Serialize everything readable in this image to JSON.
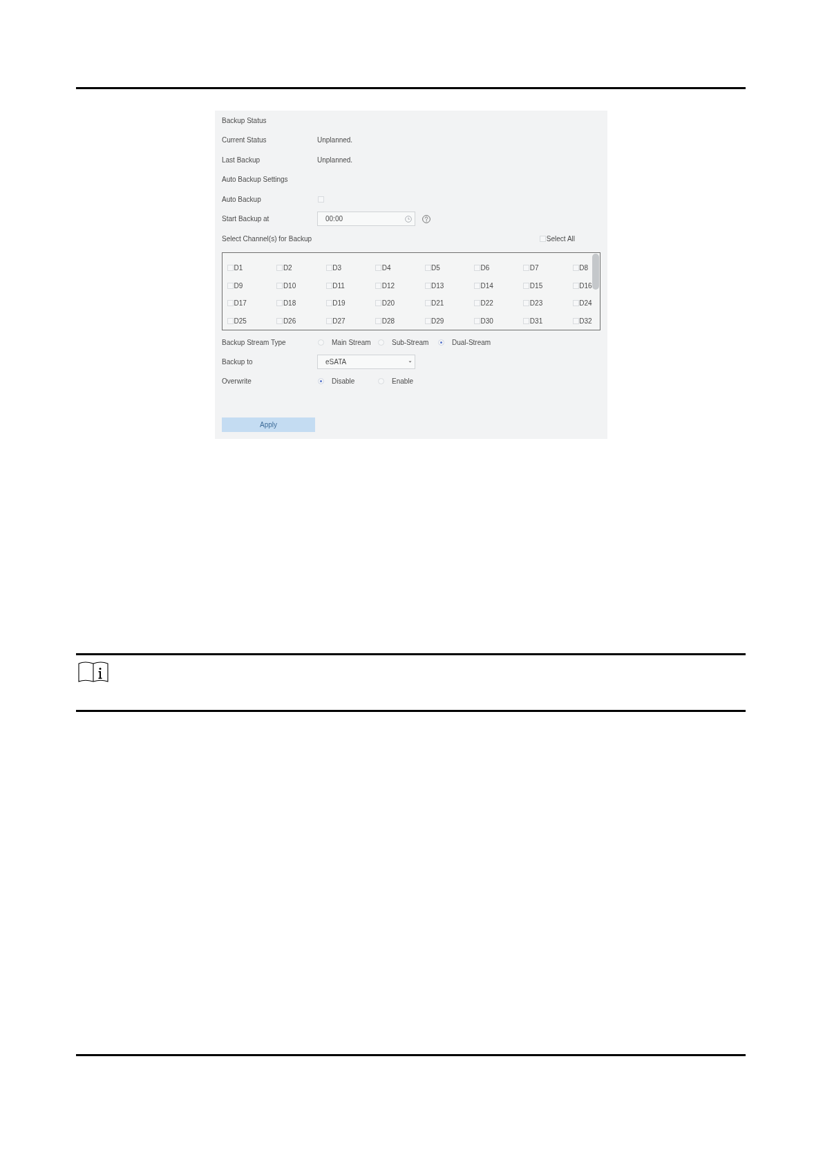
{
  "backup_status": {
    "title": "Backup Status",
    "fields": [
      {
        "label": "Current Status",
        "value": "Unplanned."
      },
      {
        "label": "Last Backup",
        "value": "Unplanned."
      }
    ]
  },
  "auto_backup_settings": {
    "title": "Auto Backup Settings",
    "auto_backup": {
      "label": "Auto Backup",
      "checked": false
    },
    "start_backup_at": {
      "label": "Start Backup at",
      "value": "00:00"
    },
    "channel_selection": {
      "label": "Select Channel(s) for Backup",
      "select_all": {
        "label": "Select All",
        "checked": false
      },
      "channels": [
        {
          "label": "D1",
          "checked": false
        },
        {
          "label": "D2",
          "checked": false
        },
        {
          "label": "D3",
          "checked": false
        },
        {
          "label": "D4",
          "checked": false
        },
        {
          "label": "D5",
          "checked": false
        },
        {
          "label": "D6",
          "checked": false
        },
        {
          "label": "D7",
          "checked": false
        },
        {
          "label": "D8",
          "checked": false
        },
        {
          "label": "D9",
          "checked": false
        },
        {
          "label": "D10",
          "checked": false
        },
        {
          "label": "D11",
          "checked": false
        },
        {
          "label": "D12",
          "checked": false
        },
        {
          "label": "D13",
          "checked": false
        },
        {
          "label": "D14",
          "checked": false
        },
        {
          "label": "D15",
          "checked": false
        },
        {
          "label": "D16",
          "checked": false
        },
        {
          "label": "D17",
          "checked": false
        },
        {
          "label": "D18",
          "checked": false
        },
        {
          "label": "D19",
          "checked": false
        },
        {
          "label": "D20",
          "checked": false
        },
        {
          "label": "D21",
          "checked": false
        },
        {
          "label": "D22",
          "checked": false
        },
        {
          "label": "D23",
          "checked": false
        },
        {
          "label": "D24",
          "checked": false
        },
        {
          "label": "D25",
          "checked": false
        },
        {
          "label": "D26",
          "checked": false
        },
        {
          "label": "D27",
          "checked": false
        },
        {
          "label": "D28",
          "checked": false
        },
        {
          "label": "D29",
          "checked": false
        },
        {
          "label": "D30",
          "checked": false
        },
        {
          "label": "D31",
          "checked": false
        },
        {
          "label": "D32",
          "checked": false
        }
      ]
    },
    "backup_stream_type": {
      "label": "Backup Stream Type",
      "options": [
        {
          "label": "Main Stream",
          "selected": false
        },
        {
          "label": "Sub-Stream",
          "selected": false
        },
        {
          "label": "Dual-Stream",
          "selected": true
        }
      ]
    },
    "backup_to": {
      "label": "Backup to",
      "value": "eSATA"
    },
    "overwrite": {
      "label": "Overwrite",
      "options": [
        {
          "label": "Disable",
          "selected": true
        },
        {
          "label": "Enable",
          "selected": false
        }
      ]
    },
    "apply_button": {
      "label": "Apply",
      "disabled": true
    }
  }
}
